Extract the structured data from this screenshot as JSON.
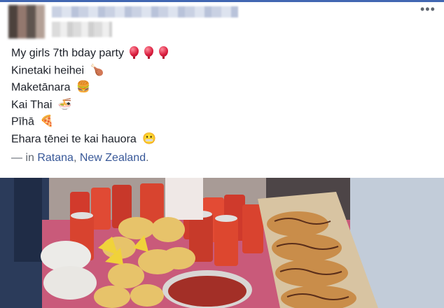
{
  "post": {
    "lines": [
      {
        "text": "My girls 7th bday party",
        "emoji": "balloon-icon"
      },
      {
        "text": "Kinetaki heihei",
        "emoji": "🍗"
      },
      {
        "text": "Maketānara",
        "emoji": "🍔"
      },
      {
        "text": "Kai Thai",
        "emoji": "🍜"
      },
      {
        "text": "Pīhā",
        "emoji": "🍕"
      },
      {
        "text": "Ehara tēnei te kai hauora",
        "emoji": "😬"
      }
    ],
    "location_prefix": "— in ",
    "location_city": "Ratana",
    "location_sep": ", ",
    "location_country": "New Zealand",
    "location_suffix": ".",
    "more_label": "•••"
  },
  "colors": {
    "accent": "#4267b2",
    "link": "#385898",
    "text": "#1d2129"
  }
}
